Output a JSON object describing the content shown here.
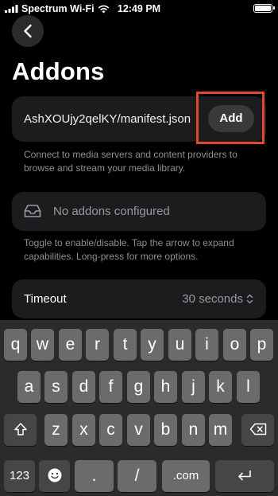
{
  "status_bar": {
    "carrier": "Spectrum Wi-Fi",
    "time": "12:49 PM"
  },
  "header": {
    "title": "Addons"
  },
  "addon_url": {
    "value": "AshXOUjy2qelKY/manifest.json",
    "add_label": "Add"
  },
  "hints": {
    "connect": "Connect to media servers and content providers to browse and stream your media library.",
    "toggle": "Toggle to enable/disable. Tap the arrow to expand capabilities. Long-press for more options."
  },
  "empty_state": {
    "label": "No addons configured"
  },
  "timeout": {
    "label": "Timeout",
    "value": "30 seconds"
  },
  "keyboard": {
    "row1": [
      "q",
      "w",
      "e",
      "r",
      "t",
      "y",
      "u",
      "i",
      "o",
      "p"
    ],
    "row2": [
      "a",
      "s",
      "d",
      "f",
      "g",
      "h",
      "j",
      "k",
      "l"
    ],
    "row3": [
      "z",
      "x",
      "c",
      "v",
      "b",
      "n",
      "m"
    ],
    "numbers_label": "123",
    "dot": ".",
    "slash": "/",
    "dotcom": ".com"
  },
  "colors": {
    "background": "#000000",
    "card": "#1c1c1e",
    "button": "#3a3a3c",
    "muted_text": "#8e8e93",
    "highlight": "#e0492c",
    "keyboard_bg": "#2b2b2d",
    "key": "#6b6b6e"
  }
}
